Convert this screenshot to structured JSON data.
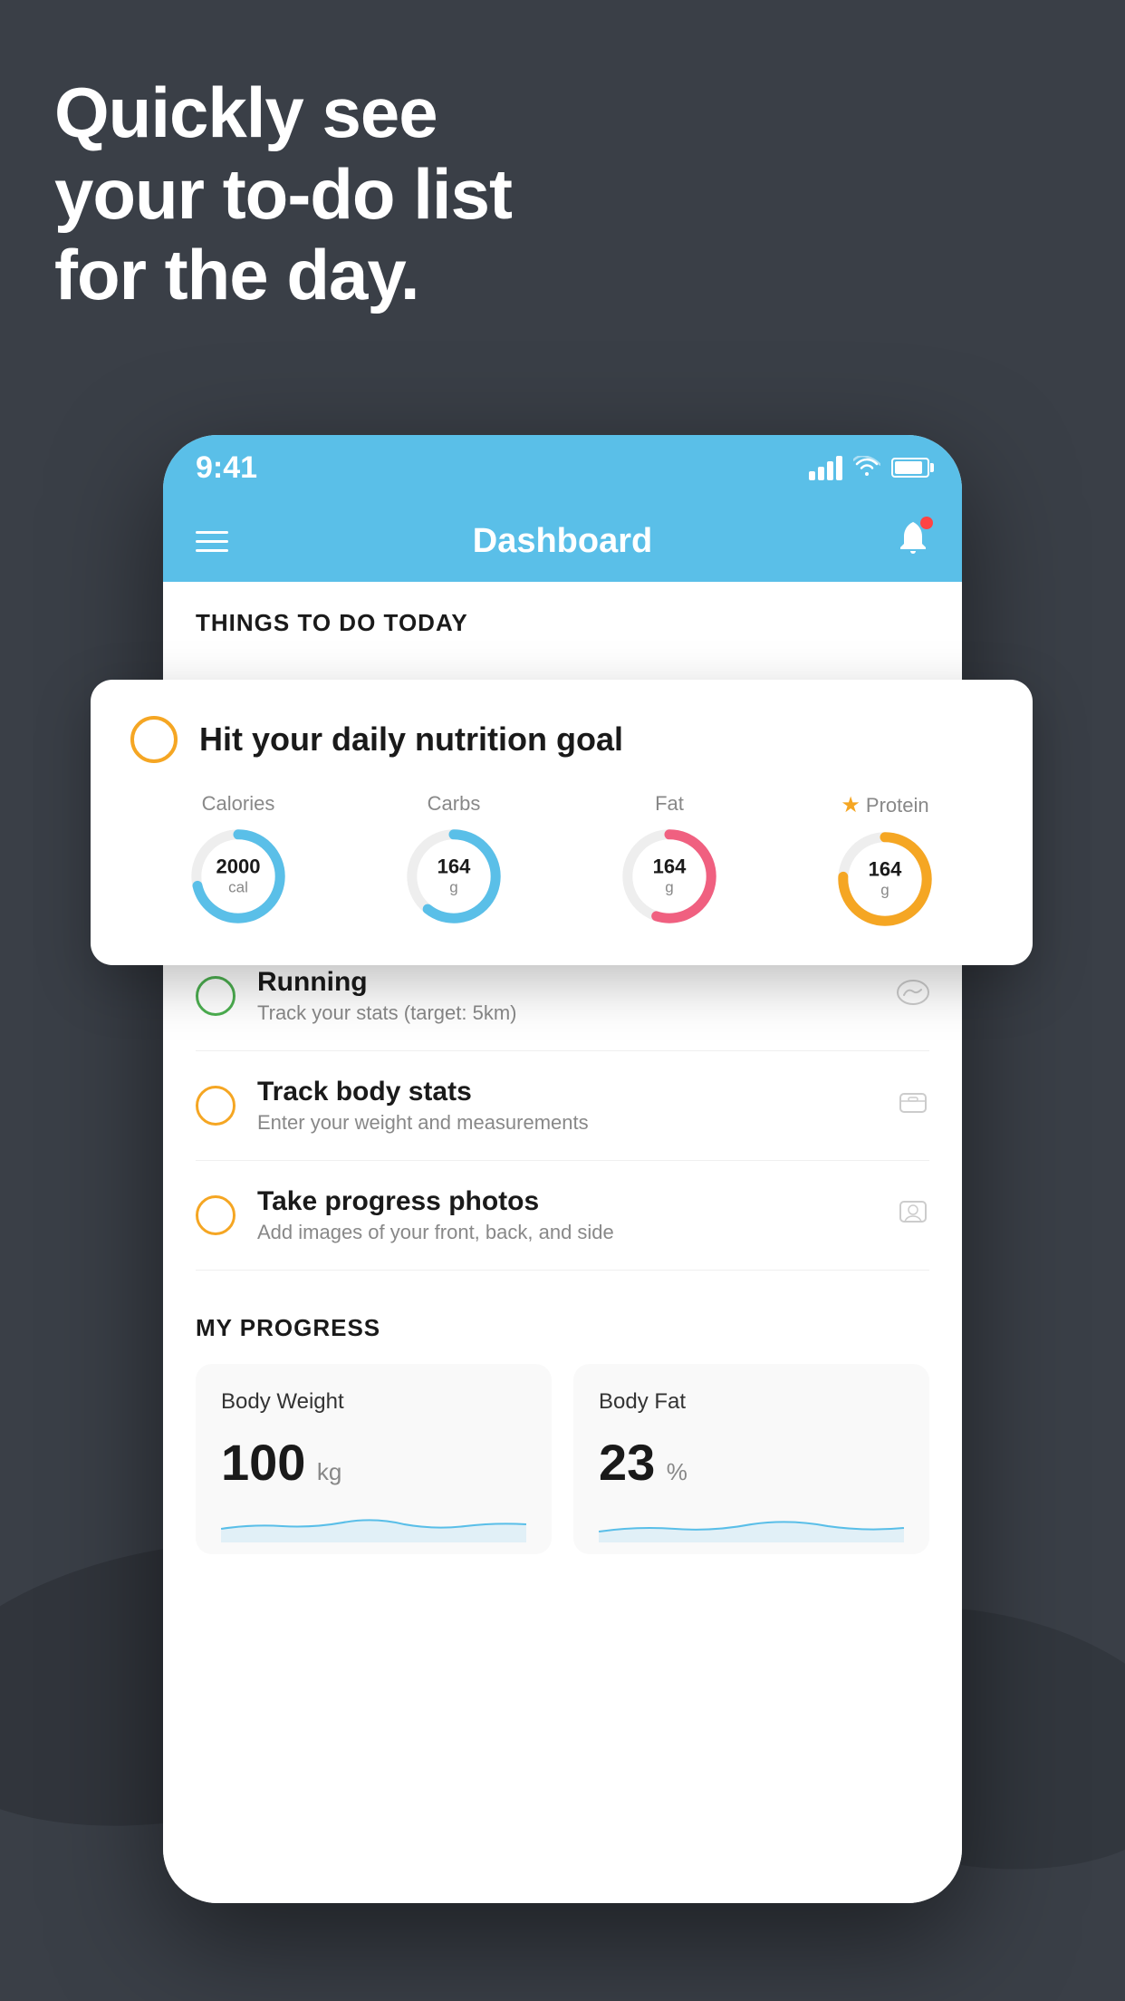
{
  "headline": {
    "line1": "Quickly see",
    "line2": "your to-do list",
    "line3": "for the day."
  },
  "status_bar": {
    "time": "9:41"
  },
  "nav": {
    "title": "Dashboard"
  },
  "section_header": "THINGS TO DO TODAY",
  "floating_card": {
    "title": "Hit your daily nutrition goal",
    "nutrition": [
      {
        "label": "Calories",
        "value": "2000",
        "unit": "cal",
        "color": "#5abfe8",
        "star": false
      },
      {
        "label": "Carbs",
        "value": "164",
        "unit": "g",
        "color": "#5abfe8",
        "star": false
      },
      {
        "label": "Fat",
        "value": "164",
        "unit": "g",
        "color": "#f06080",
        "star": false
      },
      {
        "label": "Protein",
        "value": "164",
        "unit": "g",
        "color": "#f5a623",
        "star": true
      }
    ]
  },
  "todo_items": [
    {
      "title": "Running",
      "sub": "Track your stats (target: 5km)",
      "circle_color": "green",
      "icon": "👟"
    },
    {
      "title": "Track body stats",
      "sub": "Enter your weight and measurements",
      "circle_color": "yellow",
      "icon": "⚖️"
    },
    {
      "title": "Take progress photos",
      "sub": "Add images of your front, back, and side",
      "circle_color": "yellow",
      "icon": "👤"
    }
  ],
  "progress": {
    "section_title": "MY PROGRESS",
    "cards": [
      {
        "title": "Body Weight",
        "value": "100",
        "unit": "kg"
      },
      {
        "title": "Body Fat",
        "value": "23",
        "unit": "%"
      }
    ]
  }
}
